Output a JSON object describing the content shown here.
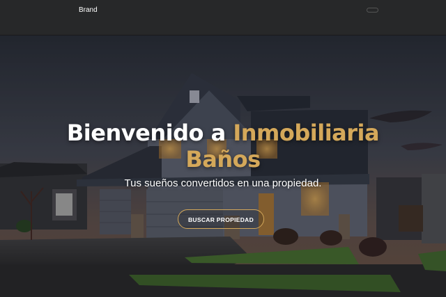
{
  "navbar": {
    "brand": "Brand",
    "toggler_icon": "hamburger-menu-icon"
  },
  "hero": {
    "title_prefix": "Bienvenido a ",
    "title_accent": "Inmobiliaria",
    "title_accent_line2": "Baños",
    "subtitle": "Tus sueños convertidos en una propiedad.",
    "cta_label": "BUSCAR PROPIEDAD"
  },
  "colors": {
    "navbar_bg": "#272829",
    "accent": "#d4a85a",
    "text": "#ffffff"
  }
}
